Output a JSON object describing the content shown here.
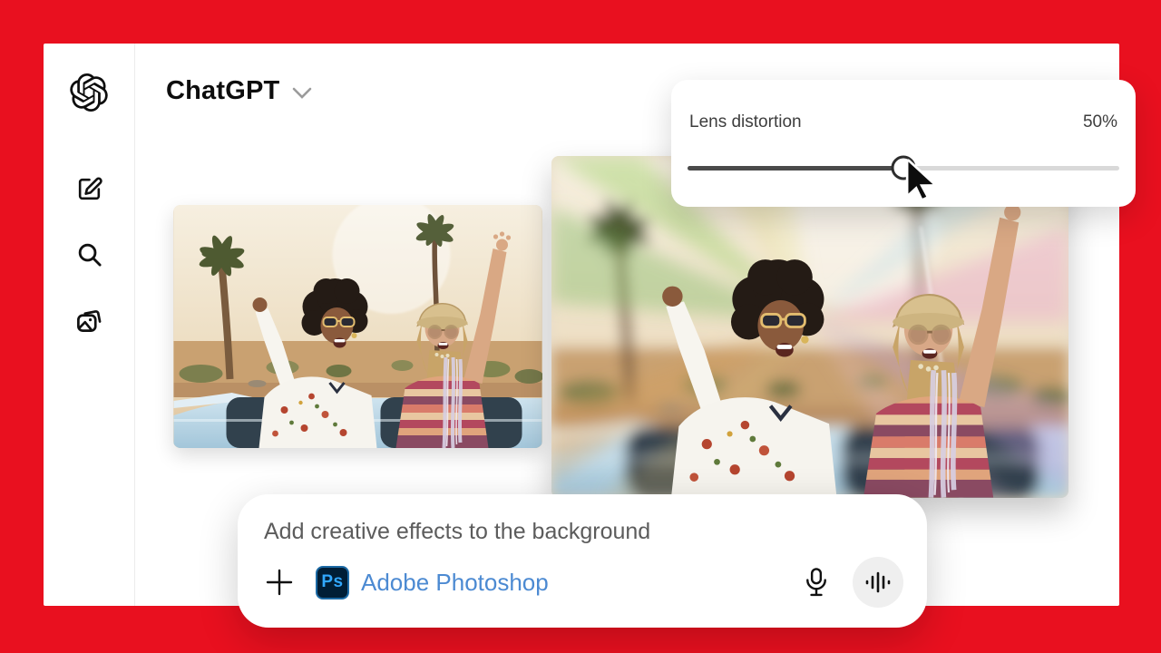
{
  "window": {
    "app_title": "ChatGPT"
  },
  "colors": {
    "frame_red": "#e9101f",
    "link_blue": "#4c8ad2",
    "ps_badge_bg": "#001e36",
    "ps_badge_text": "#31a8ff",
    "slider_fill": "#4a4a4a",
    "slider_rail": "#d9d9d9"
  },
  "sidebar": {
    "items": [
      {
        "id": "new-chat",
        "icon": "compose-icon"
      },
      {
        "id": "search",
        "icon": "search-icon"
      },
      {
        "id": "library",
        "icon": "library-icon"
      }
    ]
  },
  "header": {
    "title": "ChatGPT",
    "dropdown_icon": "chevron-down-icon"
  },
  "slider_panel": {
    "label": "Lens distortion",
    "value": "50%",
    "percent": 50
  },
  "composer": {
    "prompt": "Add creative effects to the background",
    "plugin_badge": "Ps",
    "plugin_name": "Adobe Photoshop"
  }
}
